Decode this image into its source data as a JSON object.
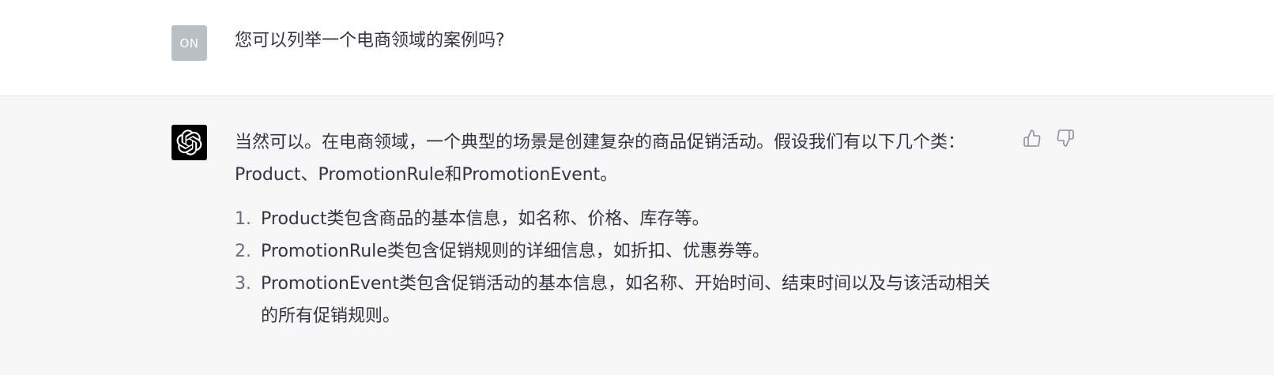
{
  "user_message": {
    "avatar_initials": "ON",
    "text": "您可以列举一个电商领域的案例吗?"
  },
  "assistant_message": {
    "avatar_icon": "openai-logo-icon",
    "intro": "当然可以。在电商领域，一个典型的场景是创建复杂的商品促销活动。假设我们有以下几个类：Product、PromotionRule和PromotionEvent。",
    "list": [
      {
        "num": "1.",
        "text": "Product类包含商品的基本信息，如名称、价格、库存等。"
      },
      {
        "num": "2.",
        "text": "PromotionRule类包含促销规则的详细信息，如折扣、优惠券等。"
      },
      {
        "num": "3.",
        "text": "PromotionEvent类包含促销活动的基本信息，如名称、开始时间、结束时间以及与该活动相关的所有促销规则。"
      }
    ],
    "feedback": {
      "thumbs_up_icon": "thumbs-up-icon",
      "thumbs_down_icon": "thumbs-down-icon"
    }
  },
  "colors": {
    "user_row_bg": "#ffffff",
    "assistant_row_bg": "#f7f7f8",
    "user_avatar_bg": "#b9bfc3",
    "bot_avatar_bg": "#000000",
    "text": "#343541"
  }
}
